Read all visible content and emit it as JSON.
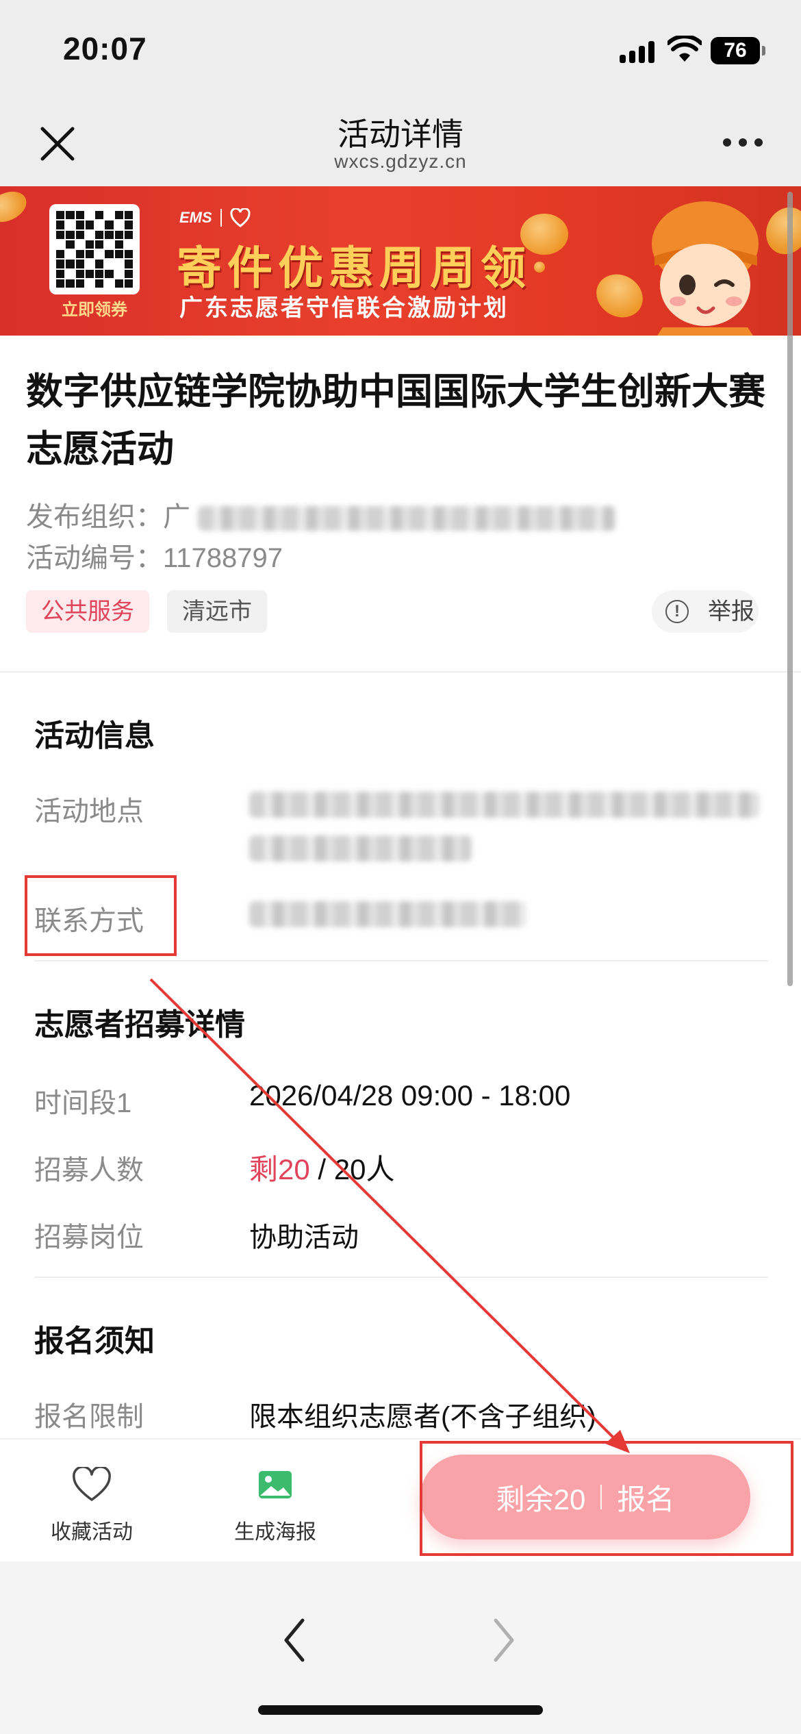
{
  "status_bar": {
    "time": "20:07",
    "battery": "76"
  },
  "nav": {
    "title": "活动详情",
    "subtitle": "wxcs.gdzyz.cn"
  },
  "banner": {
    "qr_label": "立即领券",
    "brand": "EMS",
    "headline": "寄件优惠周周领",
    "subline": "广东志愿者守信联合激励计划"
  },
  "activity": {
    "title": "数字供应链学院协助中国国际大学生创新大赛志愿活动",
    "org_label": "发布组织：",
    "org_value_visible": "广",
    "id_label": "活动编号：",
    "id_value": "11788797",
    "tags": [
      "公共服务",
      "清远市"
    ],
    "report_label": "举报"
  },
  "info_section": {
    "title": "活动信息",
    "location_label": "活动地点",
    "contact_label": "联系方式"
  },
  "recruit_section": {
    "title": "志愿者招募详情",
    "rows": [
      {
        "label": "时间段1",
        "value": "2026/04/28 09:00 - 18:00"
      },
      {
        "label": "招募人数",
        "remaining": "剩20",
        "total": " / 20人"
      },
      {
        "label": "招募岗位",
        "value": "协助活动"
      }
    ]
  },
  "notice_section": {
    "title": "报名须知",
    "limit_label": "报名限制",
    "limit_value": "限本组织志愿者(不含子组织)"
  },
  "action_bar": {
    "favorite_label": "收藏活动",
    "poster_label": "生成海报",
    "signup_remaining": "剩余20",
    "signup_label": "报名"
  },
  "colors": {
    "accent_red": "#e0435a",
    "signup_pink": "#f9a3a8",
    "annotation_red": "#e53935"
  }
}
